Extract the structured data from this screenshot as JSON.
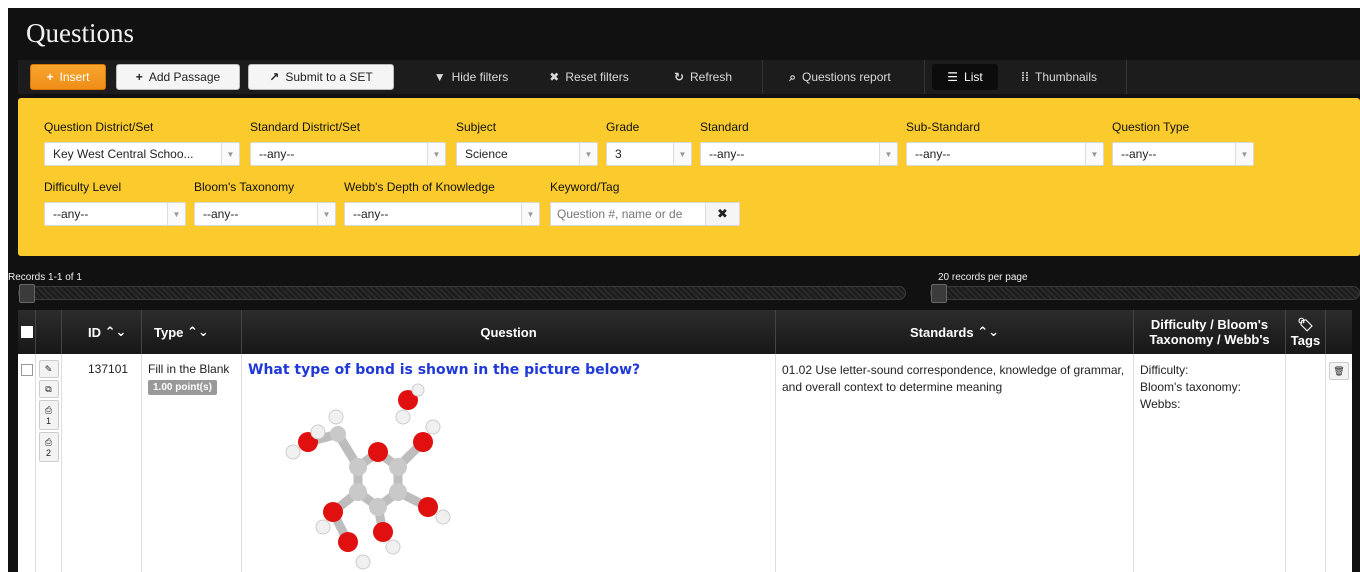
{
  "page": {
    "title": "Questions"
  },
  "toolbar": {
    "insert": "Insert",
    "add_passage": "Add Passage",
    "submit_set": "Submit to a SET",
    "hide_filters": "Hide filters",
    "reset_filters": "Reset filters",
    "refresh": "Refresh",
    "questions_report": "Questions report",
    "list": "List",
    "thumbnails": "Thumbnails"
  },
  "filters": {
    "question_district_label": "Question District/Set",
    "question_district_value": "Key West Central Schoo...",
    "standard_district_label": "Standard District/Set",
    "standard_district_value": "--any--",
    "subject_label": "Subject",
    "subject_value": "Science",
    "grade_label": "Grade",
    "grade_value": "3",
    "standard_label": "Standard",
    "standard_value": "--any--",
    "substandard_label": "Sub-Standard",
    "substandard_value": "--any--",
    "question_type_label": "Question Type",
    "question_type_value": "--any--",
    "difficulty_label": "Difficulty Level",
    "difficulty_value": "--any--",
    "blooms_label": "Bloom's Taxonomy",
    "blooms_value": "--any--",
    "webbs_label": "Webb's Depth of Knowledge",
    "webbs_value": "--any--",
    "keyword_label": "Keyword/Tag",
    "keyword_placeholder": "Question #, name or de"
  },
  "paging": {
    "records": "Records 1-1 of 1",
    "per_page": "20 records per page"
  },
  "table": {
    "headers": {
      "id": "ID",
      "type": "Type",
      "question": "Question",
      "standards": "Standards",
      "difficulty": "Difficulty / Bloom's Taxonomy / Webb's",
      "tags": "Tags"
    },
    "rows": [
      {
        "id": "137101",
        "type": "Fill in the Blank",
        "points": "1.00 point(s)",
        "question": "What type of bond is shown in the picture below?",
        "standard": "01.02 Use letter-sound correspondence, knowledge of grammar, and overall context to determine meaning",
        "difficulty": "Difficulty:",
        "blooms": "Bloom's taxonomy:",
        "webbs": "Webbs:",
        "print1": "1",
        "print2": "2"
      }
    ]
  }
}
